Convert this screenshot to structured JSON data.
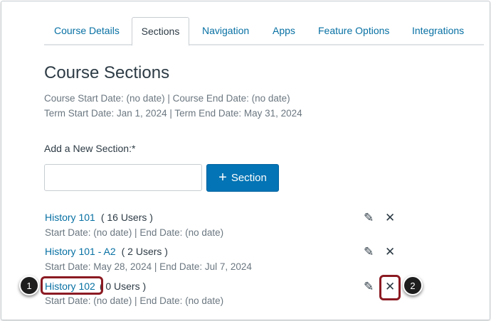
{
  "tabs": [
    "Course Details",
    "Sections",
    "Navigation",
    "Apps",
    "Feature Options",
    "Integrations"
  ],
  "active_tab": "Sections",
  "title": "Course Sections",
  "course_dates": "Course Start Date: (no date) | Course End Date: (no date)",
  "term_dates": "Term Start Date: Jan 1, 2024 | Term End Date: May 31, 2024",
  "add_label": "Add a New Section:*",
  "add_input_value": "",
  "add_button": {
    "icon": "+",
    "label": "Section"
  },
  "sections": [
    {
      "name": "History 101",
      "users": "( 16 Users )",
      "dates": "Start Date: (no date) | End Date: (no date)"
    },
    {
      "name": "History 101 - A2",
      "users": "( 2 Users )",
      "dates": "Start Date: May 28, 2024 | End Date: Jul 7, 2024"
    },
    {
      "name": "History 102",
      "users": "( 0 Users )",
      "dates": "Start Date: (no date) | End Date: (no date)"
    }
  ],
  "callouts": [
    "1",
    "2"
  ],
  "colors": {
    "link": "#0770a3",
    "button": "#0374b5",
    "highlight": "#8b1a22"
  }
}
